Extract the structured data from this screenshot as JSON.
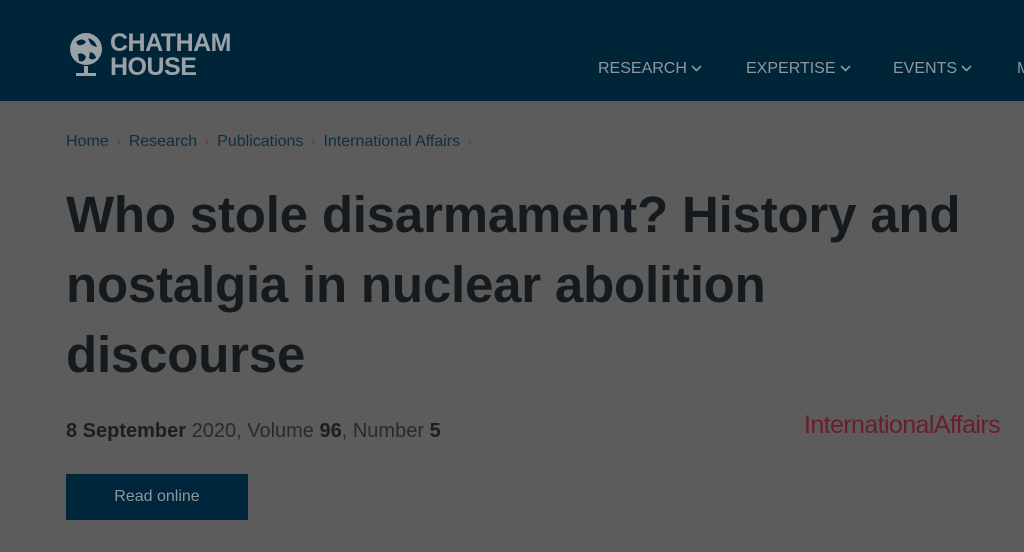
{
  "header": {
    "logo": {
      "line1": "CHATHAM",
      "line2": "HOUSE"
    },
    "nav": [
      {
        "label": "RESEARCH",
        "chevron": "⌄"
      },
      {
        "label": "EXPERTISE",
        "chevron": "⌄"
      },
      {
        "label": "EVENTS",
        "chevron": "⌄"
      },
      {
        "label": "M"
      }
    ]
  },
  "breadcrumb": [
    {
      "label": "Home"
    },
    {
      "label": "Research"
    },
    {
      "label": "Publications"
    },
    {
      "label": "International Affairs"
    }
  ],
  "breadcrumb_separator": "›",
  "article": {
    "title": "Who stole disarmament? History and nostalgia in nuclear abolition discourse",
    "date": "8 September",
    "year": " 2020, Volume ",
    "volume": "96",
    "number_label": ", Number ",
    "number": "5"
  },
  "journal_logo": {
    "text": "InternationalAffairs"
  },
  "read_button": {
    "label": "Read online"
  },
  "colors": {
    "header_bg": "#002539",
    "page_bg": "#5c5c5c",
    "button_bg": "#00263b",
    "journal_accent": "#6b1e2a"
  }
}
